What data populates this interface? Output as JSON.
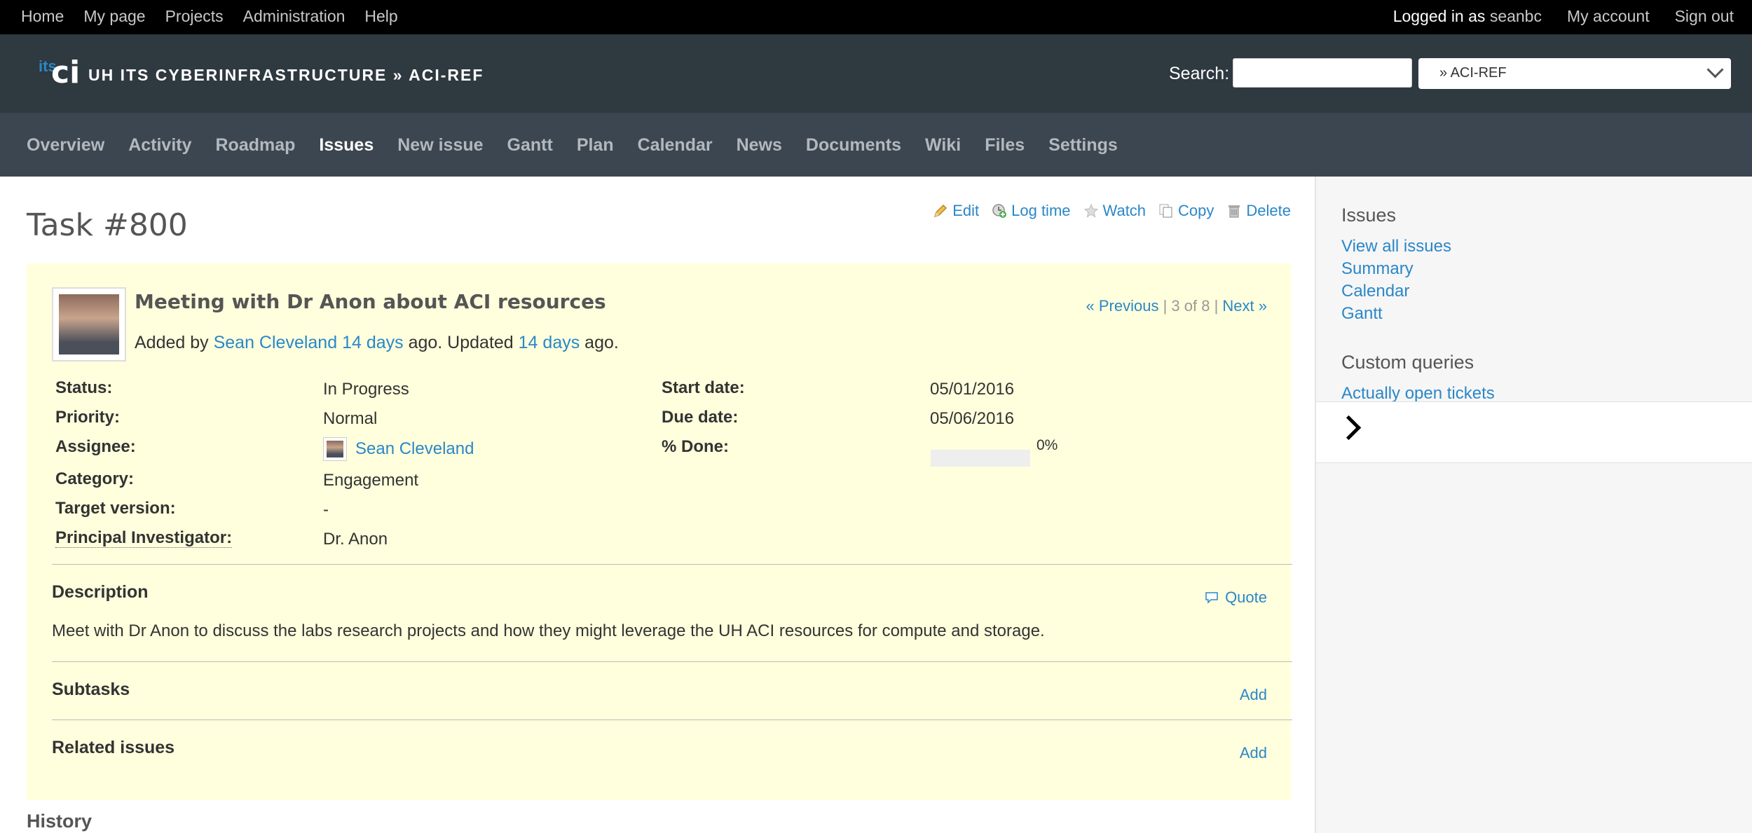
{
  "topbar": {
    "nav": [
      "Home",
      "My page",
      "Projects",
      "Administration",
      "Help"
    ],
    "logged_in_prefix": "Logged in as",
    "username": "seanbc",
    "my_account": "My account",
    "sign_out": "Sign out"
  },
  "header": {
    "logo_small": "its",
    "logo_big": "ci",
    "project_title": "UH ITS CYBERINFRASTRUCTURE » ACI-REF",
    "search_label": "Search:",
    "search_value": "",
    "project_jump": "» ACI-REF"
  },
  "menu": {
    "items": [
      "Overview",
      "Activity",
      "Roadmap",
      "Issues",
      "New issue",
      "Gantt",
      "Plan",
      "Calendar",
      "News",
      "Documents",
      "Wiki",
      "Files",
      "Settings"
    ],
    "selected": "Issues"
  },
  "actions": {
    "edit": "Edit",
    "log_time": "Log time",
    "watch": "Watch",
    "copy": "Copy",
    "delete": "Delete"
  },
  "issue": {
    "title": "Task #800",
    "subject": "Meeting with Dr Anon about ACI resources",
    "nav_prev": "« Previous",
    "nav_pos": "3 of 8",
    "nav_next": "Next »",
    "added_by": "Added by",
    "author": "Sean Cleveland",
    "created_ago": "14 days",
    "ago_updated": "ago. Updated",
    "updated_ago": "14 days",
    "ago": "ago.",
    "status_label": "Status:",
    "status": "In Progress",
    "priority_label": "Priority:",
    "priority": "Normal",
    "assignee_label": "Assignee:",
    "assignee": "Sean Cleveland",
    "category_label": "Category:",
    "category": "Engagement",
    "target_label": "Target version:",
    "target": "-",
    "pi_label": "Principal Investigator:",
    "pi": "Dr. Anon",
    "start_label": "Start date:",
    "start": "05/01/2016",
    "due_label": "Due date:",
    "due": "05/06/2016",
    "done_label": "% Done:",
    "done_percent": 0,
    "done_text": "0%",
    "description_label": "Description",
    "quote": "Quote",
    "description": "Meet with Dr Anon to discuss the labs research projects and how they might leverage the UH ACI resources for compute and storage.",
    "subtasks_label": "Subtasks",
    "related_label": "Related issues",
    "add": "Add",
    "history": "History"
  },
  "sidebar": {
    "issues_heading": "Issues",
    "links": [
      "View all issues",
      "Summary",
      "Calendar",
      "Gantt"
    ],
    "custom_heading": "Custom queries",
    "custom_link": "Actually open tickets"
  },
  "colors": {
    "topbar": "#000000",
    "header": "#2f3940",
    "menu": "#3c4650",
    "issue_bg": "#ffffdd",
    "link": "#2a87c8"
  }
}
